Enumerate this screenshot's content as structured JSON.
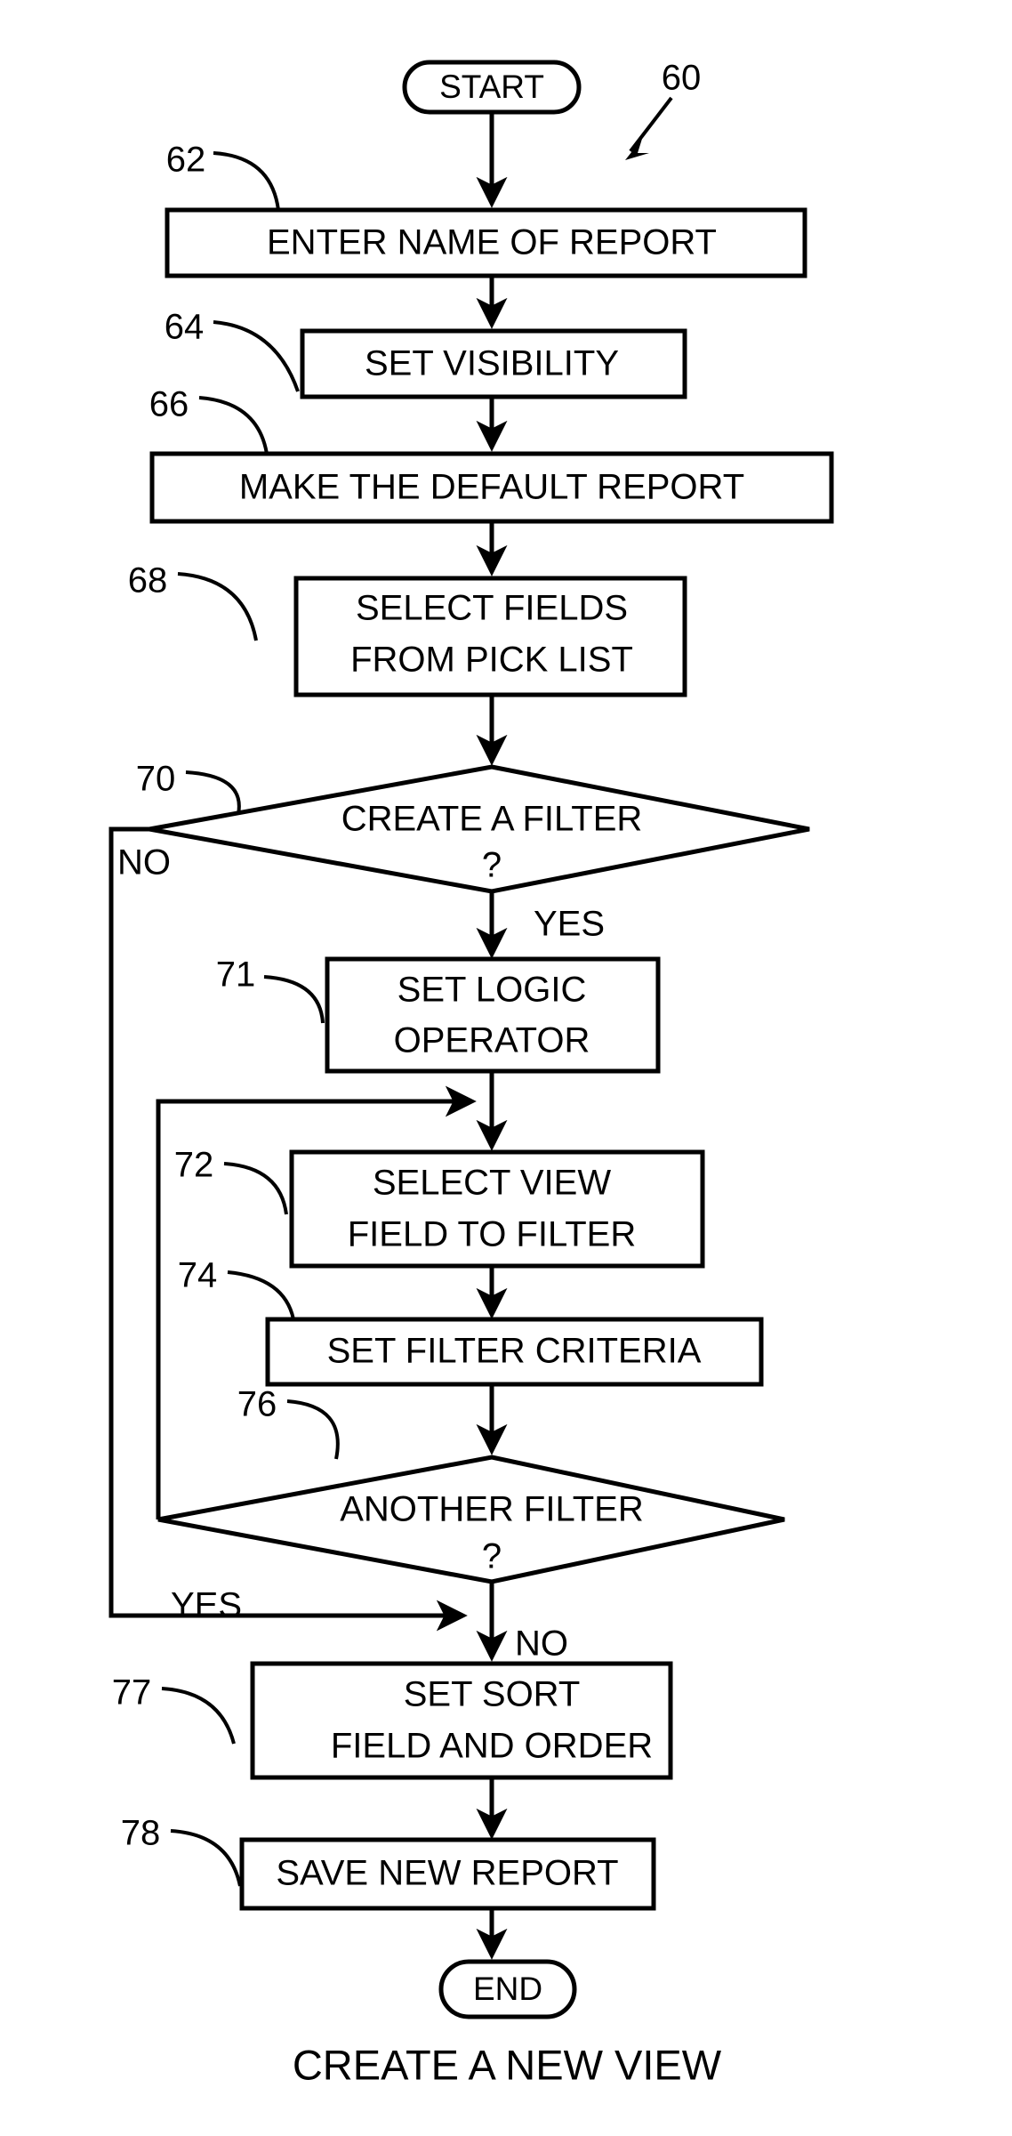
{
  "figure": {
    "title": "CREATE A NEW VIEW",
    "figure_ref": "60"
  },
  "nodes": {
    "start": {
      "ref": "",
      "text": "START"
    },
    "enter_name": {
      "ref": "62",
      "line1": "ENTER NAME OF REPORT"
    },
    "set_visibility": {
      "ref": "64",
      "line1": "SET VISIBILITY"
    },
    "make_default": {
      "ref": "66",
      "line1": "MAKE THE DEFAULT REPORT"
    },
    "select_fields": {
      "ref": "68",
      "line1": "SELECT FIELDS",
      "line2": "FROM PICK LIST"
    },
    "create_filter": {
      "ref": "70",
      "line1": "CREATE A FILTER",
      "line2": "?"
    },
    "set_logic": {
      "ref": "71",
      "line1": "SET LOGIC",
      "line2": "OPERATOR"
    },
    "select_view_field": {
      "ref": "72",
      "line1": "SELECT VIEW",
      "line2": "FIELD TO FILTER"
    },
    "set_criteria": {
      "ref": "74",
      "line1": "SET FILTER CRITERIA"
    },
    "another_filter": {
      "ref": "76",
      "line1": "ANOTHER FILTER",
      "line2": "?"
    },
    "set_sort": {
      "ref": "77",
      "line1": "SET SORT",
      "line2": "FIELD AND ORDER"
    },
    "save_report": {
      "ref": "78",
      "line1": "SAVE NEW REPORT"
    },
    "end": {
      "ref": "",
      "text": "END"
    }
  },
  "branches": {
    "create_filter_no": "NO",
    "create_filter_yes": "YES",
    "another_filter_yes": "YES",
    "another_filter_no": "NO"
  },
  "colors": {
    "ink": "#000000",
    "paper": "#ffffff"
  }
}
